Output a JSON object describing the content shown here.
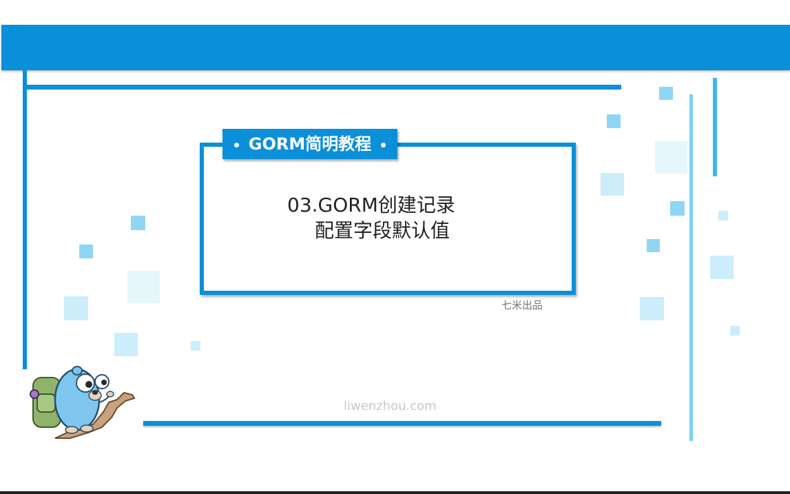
{
  "banner": {
    "tag_label": "GORM简明教程"
  },
  "slide": {
    "title_line1": "03.GORM创建记录",
    "title_line2": "配置字段默认值",
    "credit": "七米出品",
    "footer_url": "liwenzhou.com"
  },
  "colors": {
    "primary_blue": "#0a8fd9",
    "light_blue": "#8fd6f5",
    "pale_blue": "#cceefc"
  },
  "icons": {
    "mascot": "gopher-mascot-icon"
  }
}
